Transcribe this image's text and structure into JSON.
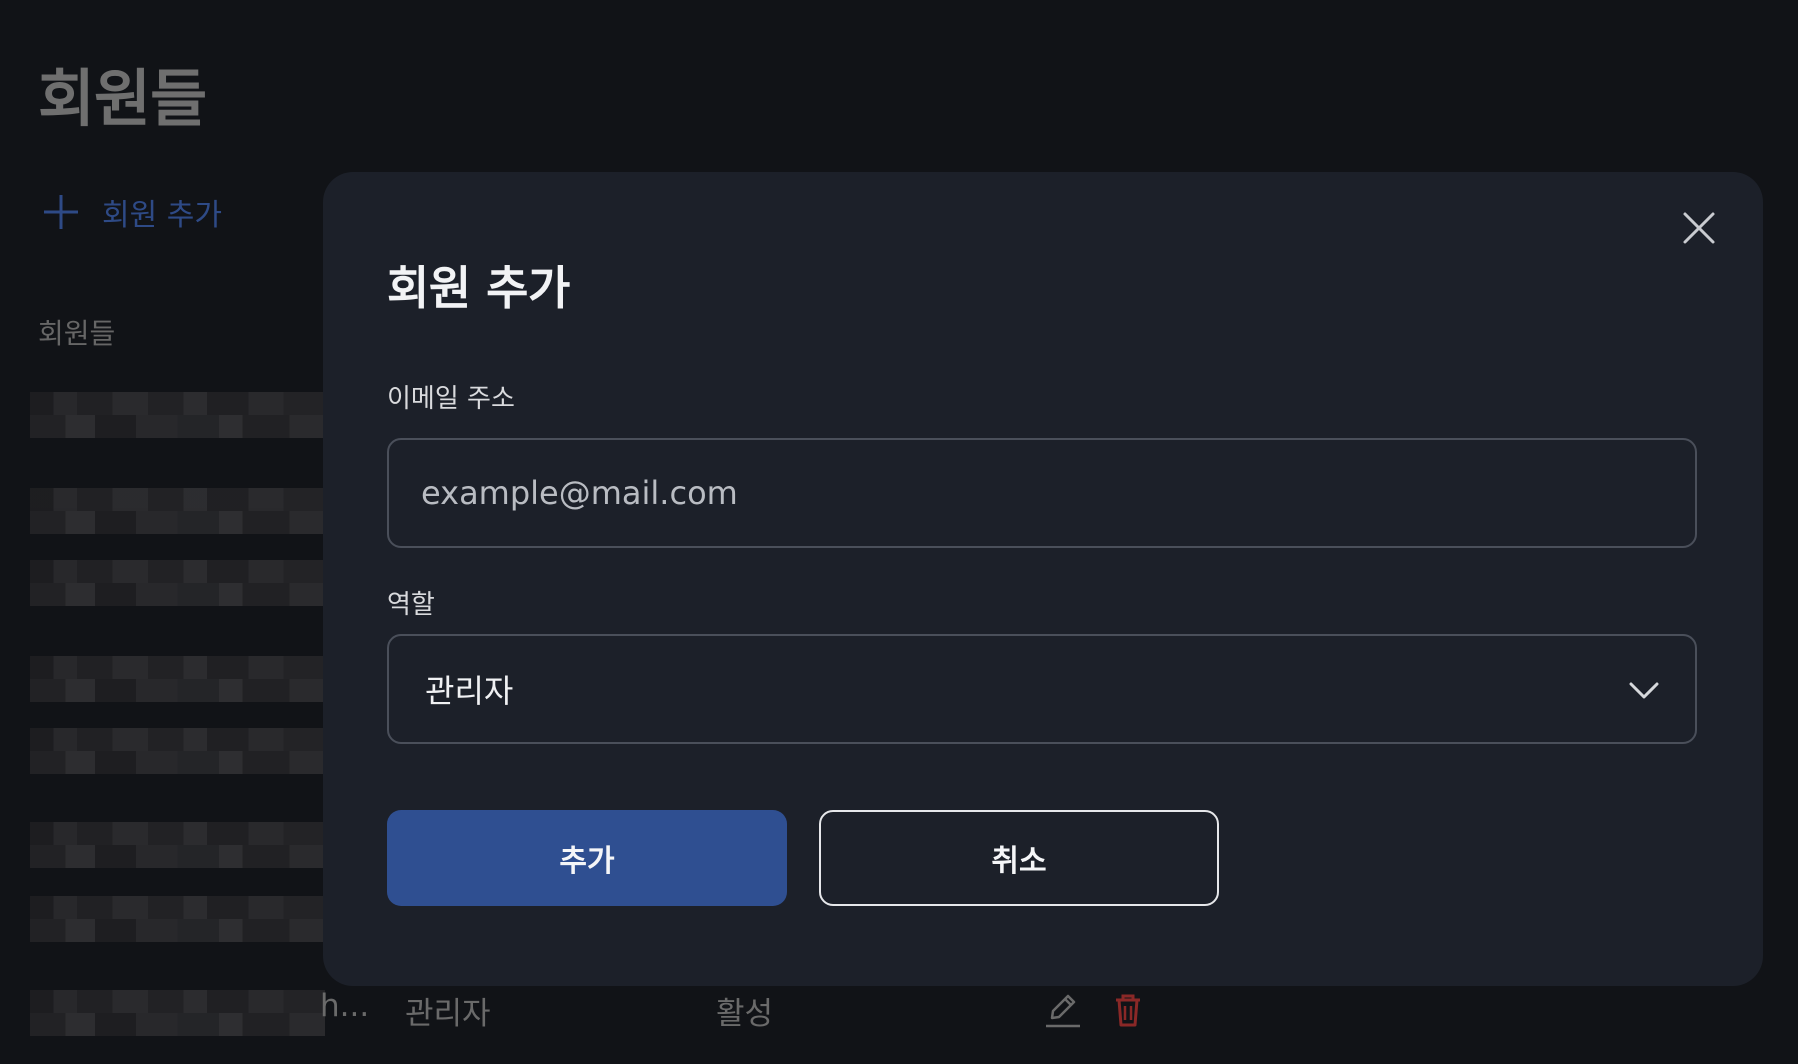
{
  "page": {
    "title": "회원들",
    "add_member_label": "회원 추가",
    "section_label": "회원들",
    "partial_row": {
      "truncated_text": "h...",
      "role": "관리자",
      "status": "활성"
    },
    "icons": [
      "plus-icon",
      "edit-icon",
      "trash-icon"
    ],
    "accent_color": "#2f4f91",
    "danger_color": "#b3302f"
  },
  "modal": {
    "title": "회원 추가",
    "email_label": "이메일 주소",
    "email_placeholder": "example@mail.com",
    "email_value": "",
    "role_label": "역할",
    "role_value": "관리자",
    "submit_label": "추가",
    "cancel_label": "취소",
    "icons": [
      "close-icon",
      "chevron-down-icon"
    ]
  }
}
